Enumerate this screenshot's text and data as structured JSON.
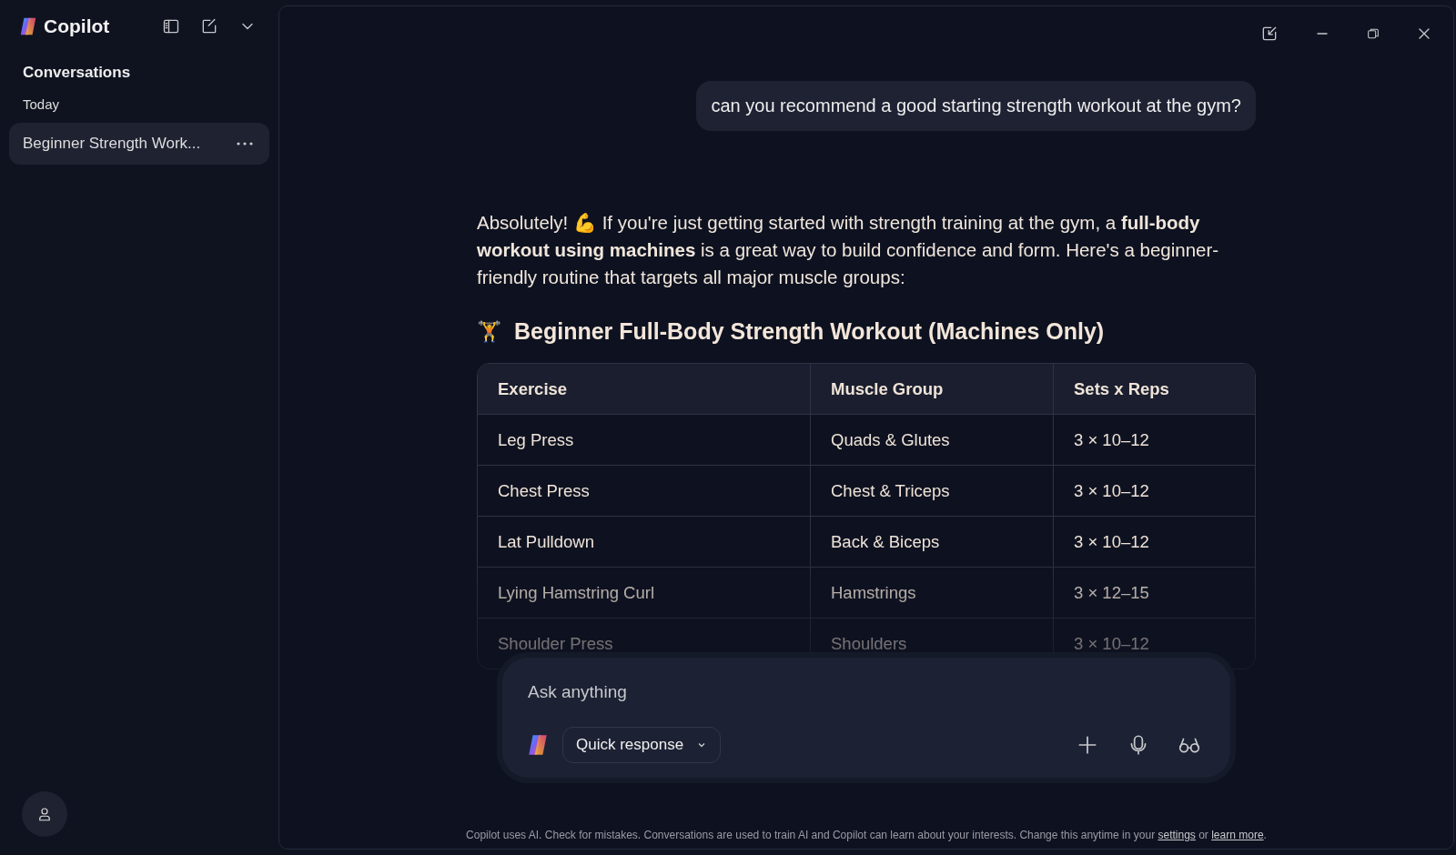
{
  "app": {
    "name": "Copilot"
  },
  "sidebar": {
    "heading": "Conversations",
    "group": "Today",
    "items": [
      {
        "title": "Beginner Strength Work...",
        "selected": true
      }
    ]
  },
  "chat": {
    "user_message": "can you recommend a good starting strength workout at the gym?",
    "reply": {
      "intro": "Absolutely! 💪 If you're just getting started with strength training at the gym, a **full-body workout using machines** is a great way to build confidence and form. Here's a beginner-friendly routine that targets all major muscle groups:",
      "heading_emoji": "🏋️",
      "heading": "Beginner Full-Body Strength Workout (Machines Only)",
      "table": {
        "columns": [
          "Exercise",
          "Muscle Group",
          "Sets x Reps"
        ],
        "rows": [
          [
            "Leg Press",
            "Quads & Glutes",
            "3 × 10–12"
          ],
          [
            "Chest Press",
            "Chest & Triceps",
            "3 × 10–12"
          ],
          [
            "Lat Pulldown",
            "Back & Biceps",
            "3 × 10–12"
          ],
          [
            "Lying Hamstring Curl",
            "Hamstrings",
            "3 × 12–15"
          ],
          [
            "Shoulder Press",
            "Shoulders",
            "3 × 10–12"
          ]
        ]
      }
    }
  },
  "composer": {
    "placeholder": "Ask anything",
    "mode": "Quick response"
  },
  "footer": {
    "text": "Copilot uses AI. Check for mistakes. Conversations are used to train AI and Copilot can learn about your interests. Change this anytime in your",
    "link_1": "settings",
    "joiner": "or",
    "link_2": "learn more",
    "end": "."
  }
}
